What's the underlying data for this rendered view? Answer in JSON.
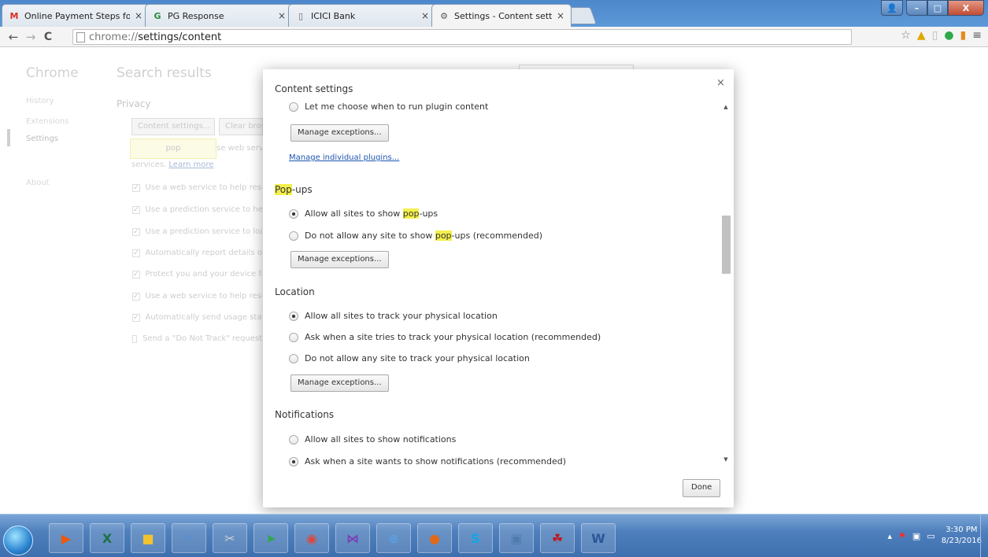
{
  "tabs": [
    {
      "title": "Online Payment Steps for",
      "icon": "gmail-icon",
      "icon_glyph": "M",
      "icon_color": "#d93025"
    },
    {
      "title": "PG Response",
      "icon": "pg-icon",
      "icon_glyph": "G",
      "icon_color": "#2a8a3e"
    },
    {
      "title": "ICICI Bank",
      "icon": "page-icon",
      "icon_glyph": "▯",
      "icon_color": "#666666"
    },
    {
      "title": "Settings - Content setting",
      "icon": "gear-icon",
      "icon_glyph": "⚙",
      "icon_color": "#555555"
    }
  ],
  "address": {
    "scheme": "chrome://",
    "path": "settings/content"
  },
  "settings_page": {
    "sidebar_title": "Chrome",
    "sidebar_items": [
      "History",
      "Extensions",
      "Settings",
      "About"
    ],
    "heading": "Search results",
    "search_value": "pop",
    "section": "Privacy",
    "content_settings_btn": "Content settings...",
    "clear_btn": "Clear brow",
    "bubble_text": "pop",
    "bubble_suffix": "se web servi",
    "services_text": "services.",
    "learn_more": "Learn more",
    "checkboxes": [
      {
        "label": "Use a web service to help reso",
        "checked": true
      },
      {
        "label": "Use a prediction service to help",
        "checked": true
      },
      {
        "label": "Use a prediction service to load",
        "checked": true
      },
      {
        "label": "Automatically report details of",
        "checked": true
      },
      {
        "label": "Protect you and your device fro",
        "checked": true
      },
      {
        "label": "Use a web service to help reso",
        "checked": true
      },
      {
        "label": "Automatically send usage stats",
        "checked": true
      },
      {
        "label": "Send a \"Do Not Track\" request",
        "checked": false
      }
    ]
  },
  "dialog": {
    "title": "Content settings",
    "plugins_radio": "Let me choose when to run plugin content",
    "manage_exceptions": "Manage exceptions...",
    "manage_plugins": "Manage individual plugins...",
    "popups": {
      "heading_hl": "Pop",
      "heading_rest": "-ups",
      "opt1_pre": "Allow all sites to show ",
      "opt1_hl": "pop",
      "opt1_post": "-ups",
      "opt2_pre": "Do not allow any site to show ",
      "opt2_hl": "pop",
      "opt2_post": "-ups (recommended)"
    },
    "location": {
      "heading": "Location",
      "opt1": "Allow all sites to track your physical location",
      "opt2": "Ask when a site tries to track your physical location (recommended)",
      "opt3": "Do not allow any site to track your physical location"
    },
    "notifications": {
      "heading": "Notifications",
      "opt1": "Allow all sites to show notifications",
      "opt2": "Ask when a site wants to show notifications (recommended)"
    },
    "done": "Done"
  },
  "taskbar": {
    "time": "3:30 PM",
    "date": "8/23/2016",
    "apps": [
      {
        "name": "media-player-icon",
        "glyph": "▶",
        "color": "#e8590c"
      },
      {
        "name": "excel-icon",
        "glyph": "X",
        "color": "#1e7145"
      },
      {
        "name": "windows-explorer-icon",
        "glyph": "■",
        "color": "#f2c230"
      },
      {
        "name": "notepad-icon",
        "glyph": "✎",
        "color": "#5a8fd0"
      },
      {
        "name": "snipping-tool-icon",
        "glyph": "✂",
        "color": "#d0d0d0"
      },
      {
        "name": "arrow-app-icon",
        "glyph": "➤",
        "color": "#2da84a"
      },
      {
        "name": "chrome-icon",
        "glyph": "◉",
        "color": "#e0453a"
      },
      {
        "name": "visual-studio-icon",
        "glyph": "⋈",
        "color": "#7b3fb6"
      },
      {
        "name": "safari-icon",
        "glyph": "⊕",
        "color": "#5aa0e0"
      },
      {
        "name": "firefox-icon",
        "glyph": "●",
        "color": "#e06a1a"
      },
      {
        "name": "skype-icon",
        "glyph": "S",
        "color": "#12a5e6"
      },
      {
        "name": "network-icon",
        "glyph": "▣",
        "color": "#4f7bb0"
      },
      {
        "name": "acrobat-icon",
        "glyph": "☘",
        "color": "#c0181b"
      },
      {
        "name": "word-icon",
        "glyph": "W",
        "color": "#2b5797"
      }
    ]
  }
}
